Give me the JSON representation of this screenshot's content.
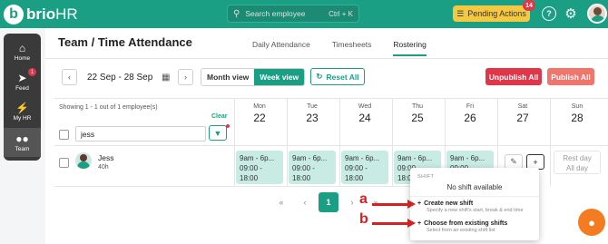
{
  "brand": {
    "logo_mark": "b",
    "name_a": "brio",
    "name_b": "HR"
  },
  "search": {
    "placeholder": "Search employee",
    "shortcut": "Ctrl + K",
    "icon": "search-icon"
  },
  "pending": {
    "label": "Pending Actions",
    "count": "14"
  },
  "sidebar": {
    "items": [
      {
        "label": "Home",
        "icon": "home-icon"
      },
      {
        "label": "Feed",
        "icon": "megaphone-icon",
        "badge": "1"
      },
      {
        "label": "My HR",
        "icon": "lightning-icon"
      },
      {
        "label": "Team",
        "icon": "team-icon"
      }
    ]
  },
  "page": {
    "breadcrumb": "Team / Time Attendance",
    "tabs": [
      "Daily Attendance",
      "Timesheets",
      "Rostering"
    ],
    "active_tab": "Rostering"
  },
  "toolbar": {
    "date_range": "22 Sep - 28 Sep",
    "month_view": "Month view",
    "week_view": "Week view",
    "reset": "Reset All",
    "unpublish": "Unpublish All",
    "publish": "Publish All"
  },
  "grid": {
    "showing": "Showing 1 - 1 out of 1 employee(s)",
    "clear": "Clear",
    "filter_value": "jess",
    "days": [
      {
        "name": "Mon",
        "date": "22"
      },
      {
        "name": "Tue",
        "date": "23"
      },
      {
        "name": "Wed",
        "date": "24"
      },
      {
        "name": "Thu",
        "date": "25"
      },
      {
        "name": "Fri",
        "date": "26"
      },
      {
        "name": "Sat",
        "date": "27"
      },
      {
        "name": "Sun",
        "date": "28"
      }
    ]
  },
  "employee": {
    "name": "Jess",
    "hours": "40h",
    "shift_line1": "9am - 6p...",
    "shift_line2": "09:00 -",
    "shift_line3": "18:00",
    "rest_line1": "Rest day",
    "rest_line2": "All day"
  },
  "popup": {
    "header": "SHIFT",
    "empty": "No shift available",
    "create_title": "Create new shift",
    "create_desc": "Specify a new shift's start, break & end time",
    "choose_title": "Choose from existing shifts",
    "choose_desc": "Select from an existing shift list"
  },
  "pagination": {
    "first": "«",
    "prev": "‹",
    "current": "1",
    "next": "›",
    "last": "»"
  },
  "annotations": {
    "a": "a",
    "b": "b"
  },
  "colors": {
    "primary": "#1a9e84",
    "danger": "#e0364a",
    "publish": "#f0756a",
    "pending": "#f5c842",
    "annotation": "#d8201f",
    "fab": "#f47b20"
  }
}
